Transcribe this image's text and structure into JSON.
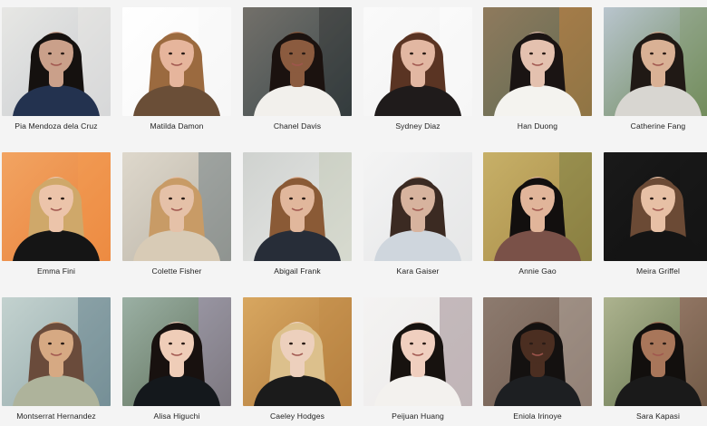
{
  "people": [
    {
      "name": "Pia Mendoza dela Cruz",
      "bg": "#c9ccd1",
      "bg2": "#e7e7e4",
      "hair": "#15110f",
      "skin": "#caa08a",
      "top": "#23324f",
      "accent": "#f0efe8"
    },
    {
      "name": "Matilda Damon",
      "bg": "#f7f7f7",
      "bg2": "#ffffff",
      "hair": "#9b6a3f",
      "skin": "#e6b59c",
      "top": "#6a4e37",
      "accent": "#f7f7f7"
    },
    {
      "name": "Chanel Davis",
      "bg": "#3d4a4d",
      "bg2": "#73706a",
      "hair": "#1b120f",
      "skin": "#8b5b3f",
      "top": "#f2f0ec",
      "accent": "#222222"
    },
    {
      "name": "Sydney Diaz",
      "bg": "#f2f2f2",
      "bg2": "#fafafa",
      "hair": "#5a3423",
      "skin": "#e2b7a2",
      "top": "#1f1b1b",
      "accent": "#ffffff"
    },
    {
      "name": "Han Duong",
      "bg": "#5d6a53",
      "bg2": "#8f7a5d",
      "hair": "#1a1413",
      "skin": "#e4c1af",
      "top": "#f4f3ef",
      "accent": "#ef8a2b"
    },
    {
      "name": "Catherine Fang",
      "bg": "#6b8756",
      "bg2": "#b9c5ce",
      "hair": "#201915",
      "skin": "#d9b195",
      "top": "#d8d6d1",
      "accent": "#7e9660"
    },
    {
      "name": "Emma Fini",
      "bg": "#e8813a",
      "bg2": "#f2a462",
      "hair": "#cfa86a",
      "skin": "#ecc4aa",
      "top": "#151515",
      "accent": "#f59e50"
    },
    {
      "name": "Colette Fisher",
      "bg": "#b9b2a5",
      "bg2": "#ded8cc",
      "hair": "#c89b66",
      "skin": "#e5c1a8",
      "top": "#d8cbb6",
      "accent": "#415b6a"
    },
    {
      "name": "Abigail Frank",
      "bg": "#e8e8e7",
      "bg2": "#cfd2cf",
      "hair": "#8a5a36",
      "skin": "#e1b79c",
      "top": "#272d38",
      "accent": "#b7c0a3"
    },
    {
      "name": "Kara Gaiser",
      "bg": "#e4e5e6",
      "bg2": "#f4f4f4",
      "hair": "#3b2a22",
      "skin": "#d7b39e",
      "top": "#cfd6dd",
      "accent": "#ececec"
    },
    {
      "name": "Annie Gao",
      "bg": "#a78b47",
      "bg2": "#c7b068",
      "hair": "#120f0e",
      "skin": "#e1b59a",
      "top": "#7a5148",
      "accent": "#566a36"
    },
    {
      "name": "Meira Griffel",
      "bg": "#0f0f0f",
      "bg2": "#1a1a1a",
      "hair": "#6b4a35",
      "skin": "#e7c0a5",
      "top": "#141414",
      "accent": "#1d1d1d"
    },
    {
      "name": "Montserrat Hernandez",
      "bg": "#93a8aa",
      "bg2": "#c3d2cf",
      "hair": "#6a4b3b",
      "skin": "#d6a983",
      "top": "#aeb39b",
      "accent": "#3f6173"
    },
    {
      "name": "Alisa Higuchi",
      "bg": "#5b6c55",
      "bg2": "#9bb0a4",
      "hair": "#18110f",
      "skin": "#efcdb8",
      "top": "#14181c",
      "accent": "#bc8fd2"
    },
    {
      "name": "Caeley Hodges",
      "bg": "#b07a3d",
      "bg2": "#d8a760",
      "hair": "#dcc08c",
      "skin": "#edd0bd",
      "top": "#1b1b1b",
      "accent": "#c08945"
    },
    {
      "name": "Peijuan Huang",
      "bg": "#eceae9",
      "bg2": "#f4f3f2",
      "hair": "#17120f",
      "skin": "#f0cfbf",
      "top": "#f3f1ee",
      "accent": "#71545b"
    },
    {
      "name": "Eniola Irinoye",
      "bg": "#6f5a4e",
      "bg2": "#8d7b6f",
      "hair": "#141110",
      "skin": "#4b2e21",
      "top": "#1d1f22",
      "accent": "#d4ccc3"
    },
    {
      "name": "Sara Kapasi",
      "bg": "#60714a",
      "bg2": "#adb38f",
      "hair": "#120f0d",
      "skin": "#a8765a",
      "top": "#1a1a1a",
      "accent": "#8e2e3f"
    }
  ]
}
